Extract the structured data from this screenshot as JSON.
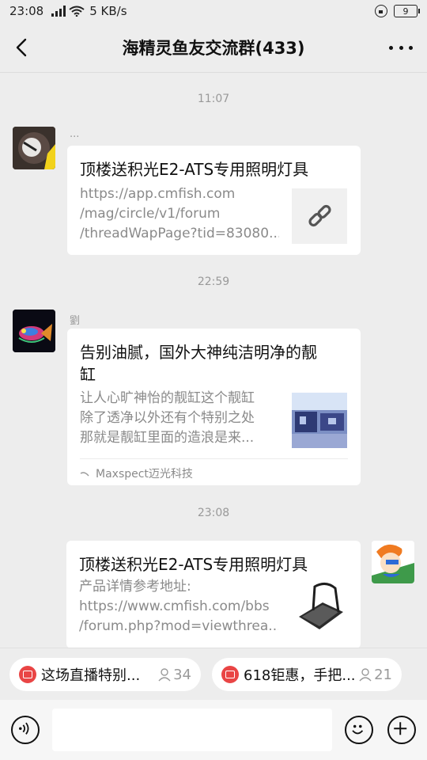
{
  "status": {
    "time": "23:08",
    "network_type": "4G",
    "speed": "5 KB/s",
    "battery": "9"
  },
  "header": {
    "title": "海精灵鱼友交流群(433)"
  },
  "messages": [
    {
      "timestamp": "11:07",
      "sender": "...",
      "title": "顶楼送积光E2-ATS专用照明灯具",
      "desc": [
        "https://app.cmfish.com",
        "/mag/circle/v1/forum",
        "/threadWapPage?tid=83080..."
      ],
      "thumb_icon": "link-icon"
    },
    {
      "timestamp": "22:59",
      "sender": "劉",
      "title_lines": [
        "告别油腻，国外大神纯洁明净的靓",
        "缸"
      ],
      "desc": [
        "让人心旷神怡的靓缸这个靓缸",
        "除了透净以外还有个特别之处",
        "那就是靓缸里面的造浪是来..."
      ],
      "source": "Maxspect迈光科技"
    },
    {
      "timestamp": "23:08",
      "title": "顶楼送积光E2-ATS专用照明灯具",
      "desc": [
        "产品详情参考地址:",
        "https://www.cmfish.com/bbs",
        "/forum.php?mod=viewthrea..."
      ]
    }
  ],
  "tips": [
    {
      "text": "这场直播特别...",
      "count": "34"
    },
    {
      "text": "618钜惠，手把...",
      "count": "21"
    }
  ],
  "colors": {
    "background": "#ededed",
    "card": "#ffffff",
    "live_badge": "#e94545"
  }
}
